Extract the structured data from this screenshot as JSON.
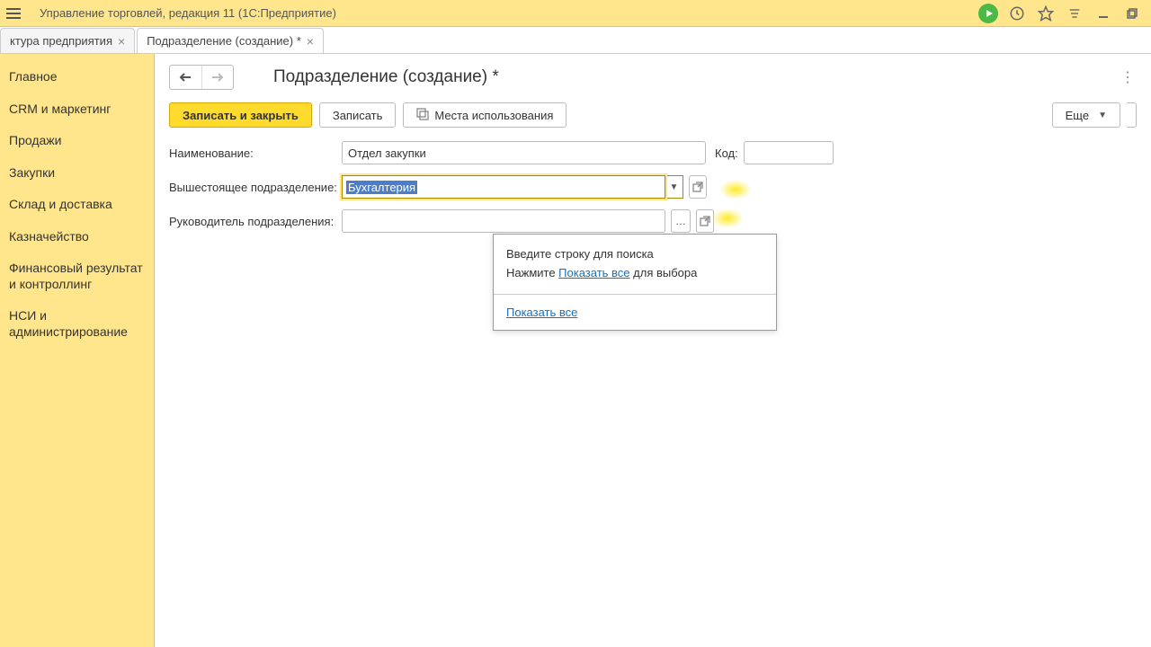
{
  "titlebar": {
    "title": "Управление торговлей, редакция 11  (1С:Предприятие)"
  },
  "tabs": [
    {
      "label": "ктура предприятия"
    },
    {
      "label": "Подразделение (создание) *"
    }
  ],
  "sidebar": {
    "items": [
      {
        "label": "Главное"
      },
      {
        "label": "CRM и маркетинг"
      },
      {
        "label": "Продажи"
      },
      {
        "label": "Закупки"
      },
      {
        "label": "Склад и доставка"
      },
      {
        "label": "Казначейство"
      },
      {
        "label": "Финансовый результат и контроллинг"
      },
      {
        "label": "НСИ и администрирование"
      }
    ]
  },
  "page": {
    "title": "Подразделение (создание) *"
  },
  "toolbar": {
    "save_close": "Записать и закрыть",
    "save": "Записать",
    "usage": "Места использования",
    "more": "Еще"
  },
  "form": {
    "name_label": "Наименование:",
    "name_value": "Отдел закупки",
    "code_label": "Код:",
    "code_value": "",
    "parent_label": "Вышестоящее подразделение:",
    "parent_value": "Бухгалтерия",
    "head_label": "Руководитель подразделения:",
    "head_value": ""
  },
  "dropdown": {
    "hint1": "Введите строку для поиска",
    "hint2_prefix": "Нажмите ",
    "hint2_link": "Показать все",
    "hint2_suffix": " для выбора",
    "show_all": "Показать все"
  }
}
